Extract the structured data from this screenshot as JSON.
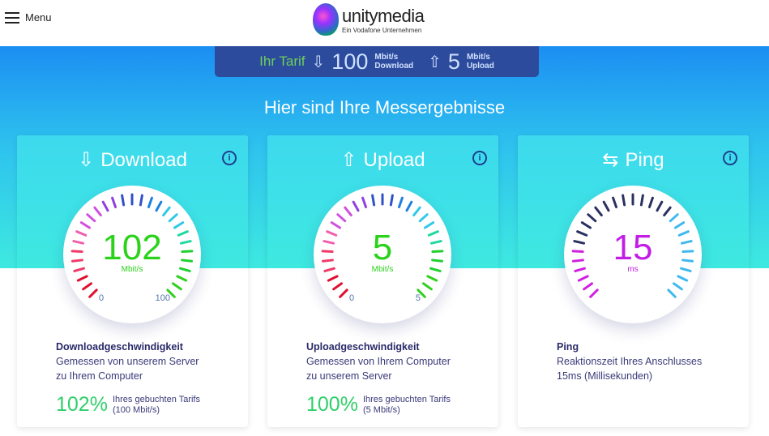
{
  "header": {
    "menu_label": "Menu",
    "logo_name": "unitymedia",
    "logo_tagline": "Ein Vodafone Unternehmen"
  },
  "tarif": {
    "label": "Ihr Tarif",
    "download_value": "100",
    "download_unit": "Mbit/s",
    "download_label": "Download",
    "upload_value": "5",
    "upload_unit": "Mbit/s",
    "upload_label": "Upload"
  },
  "title": "Hier sind Ihre Messergebnisse",
  "cards": [
    {
      "title": "Download",
      "icon": "download-icon",
      "value": "102",
      "unit": "Mbit/s",
      "min": "0",
      "max": "100",
      "value_color": "#2ad21a",
      "unit_color": "#2ad21a",
      "fill": 1.0,
      "palette": "speed",
      "desc_title": "Downloadgeschwindigkeit",
      "desc_line1": "Gemessen von unserem Server",
      "desc_line2": "zu Ihrem Computer",
      "percent": "102%",
      "percent_text1": "Ihres gebuchten Tarifs",
      "percent_text2": "(100 Mbit/s)"
    },
    {
      "title": "Upload",
      "icon": "upload-icon",
      "value": "5",
      "unit": "Mbit/s",
      "min": "0",
      "max": "5",
      "value_color": "#2ad21a",
      "unit_color": "#2ad21a",
      "fill": 1.0,
      "palette": "speed",
      "desc_title": "Uploadgeschwindigkeit",
      "desc_line1": "Gemessen von Ihrem Computer",
      "desc_line2": "zu unserem Server",
      "percent": "100%",
      "percent_text1": "Ihres gebuchten Tarifs",
      "percent_text2": "(5 Mbit/s)"
    },
    {
      "title": "Ping",
      "icon": "ping-icon",
      "value": "15",
      "unit": "ms",
      "value_color": "#c21ee6",
      "unit_color": "#c21ee6",
      "fill": 0.2,
      "palette": "ping",
      "desc_title": "Ping",
      "desc_line1": "Reaktionszeit Ihres Anschlusses",
      "desc_line2": "15ms (Millisekunden)"
    }
  ]
}
